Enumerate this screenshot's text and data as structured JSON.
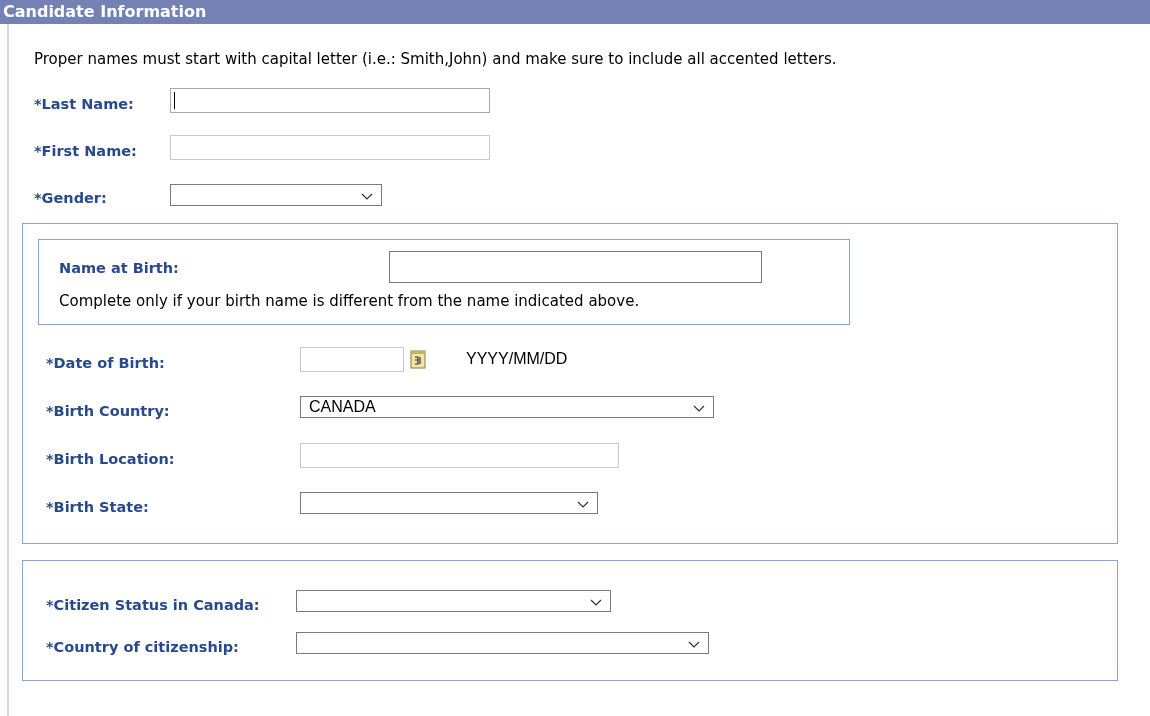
{
  "section_title": "Candidate Information",
  "instructions": "Proper names must start with capital letter (i.e.: Smith,John) and make sure to include all accented letters.",
  "name_fields": [
    {
      "kind": "text",
      "label": "*Last Name:",
      "focused": true
    },
    {
      "kind": "text",
      "label": "*First Name:",
      "focused": false
    },
    {
      "kind": "select",
      "label": "*Gender:"
    }
  ],
  "birth_name": {
    "label": "Name at Birth:",
    "note": "Complete only if your birth name is different from the name indicated above."
  },
  "birth_fields": [
    {
      "kind": "date",
      "label": "*Date of Birth:",
      "format": "YYYY/MM/DD"
    },
    {
      "kind": "select",
      "label": "*Birth Country:",
      "value": "CANADA"
    },
    {
      "kind": "text",
      "label": "*Birth Location:",
      "focused": false
    },
    {
      "kind": "select",
      "label": "*Birth State:"
    }
  ],
  "citizen_fields": [
    {
      "kind": "select",
      "label": "*Citizen Status in Canada:"
    },
    {
      "kind": "select",
      "label": "*Country of citizenship:"
    }
  ]
}
